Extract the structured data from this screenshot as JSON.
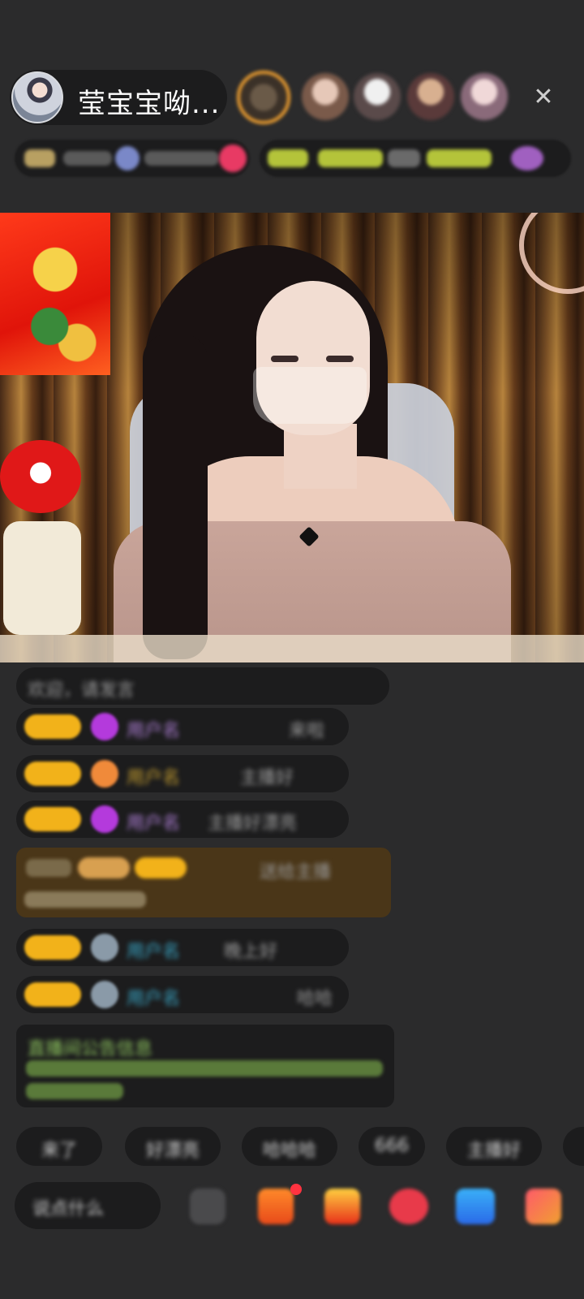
{
  "host": {
    "name": "莹宝宝呦..."
  },
  "header": {
    "close_icon": "close-icon",
    "viewer_count": 5
  },
  "chat": {
    "messages": [
      {
        "text": "欢迎，请发言"
      },
      {
        "user": "用户名",
        "text": "来啦"
      },
      {
        "user": "用户名",
        "text": "主播好"
      },
      {
        "user": "用户名",
        "text": "主播好漂亮"
      },
      {
        "user": "用户名",
        "text": "送给主播"
      },
      {
        "user": "用户名",
        "text": "晚上好"
      },
      {
        "user": "用户名",
        "text": "哈哈"
      },
      {
        "text": "直播间公告信息"
      }
    ]
  },
  "quick_replies": [
    "来了",
    "好漂亮",
    "哈哈哈",
    "666",
    "主播好"
  ],
  "bottom_bar": {
    "input_placeholder": "说点什么",
    "tools": [
      "emoji-icon",
      "gift-box-icon",
      "present-icon",
      "heart-icon",
      "game-icon",
      "more-icon"
    ]
  },
  "colors": {
    "background": "#2b2b2c",
    "pill": "#1c1c1d",
    "level_badge": "#f2b21a",
    "accent_red": "#ff3340"
  }
}
